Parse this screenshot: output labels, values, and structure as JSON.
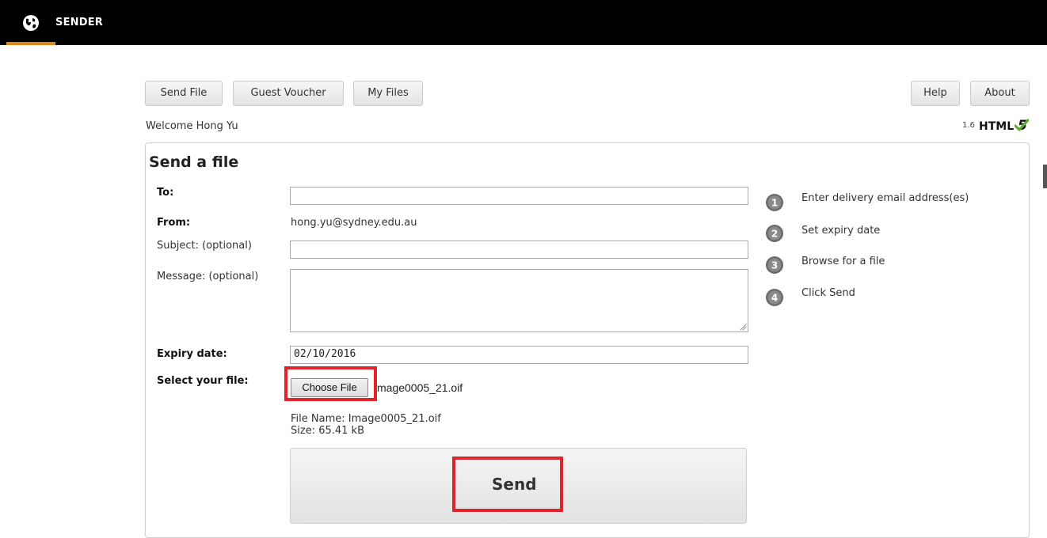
{
  "app": {
    "title": "SENDER",
    "logo_icon": "globe-icon",
    "accent": "#e0891b"
  },
  "nav": {
    "send_file": "Send File",
    "guest_voucher": "Guest Voucher",
    "my_files": "My Files",
    "help": "Help",
    "about": "About"
  },
  "welcome": "Welcome Hong Yu",
  "version": "1.6",
  "html5": {
    "text": "HTML",
    "five": "5",
    "check_icon": "check-icon"
  },
  "form": {
    "title": "Send a file",
    "to_label": "To:",
    "to_value": "",
    "from_label": "From:",
    "from_value": "hong.yu@sydney.edu.au",
    "subject_label": "Subject: (optional)",
    "subject_value": "",
    "message_label": "Message: (optional)",
    "message_value": "",
    "expiry_label": "Expiry date:",
    "expiry_value": "02/10/2016",
    "file_label": "Select your file:",
    "choose_file": "Choose File",
    "chosen_file": "mage0005_21.oif",
    "file_name": "File Name: Image0005_21.oif",
    "file_size": "Size: 65.41 kB",
    "send": "Send",
    "highlight_color": "#e0242b"
  },
  "steps": [
    {
      "num": "1",
      "text": "Enter delivery email address(es)"
    },
    {
      "num": "2",
      "text": "Set expiry date"
    },
    {
      "num": "3",
      "text": "Browse for a file"
    },
    {
      "num": "4",
      "text": "Click Send"
    }
  ]
}
